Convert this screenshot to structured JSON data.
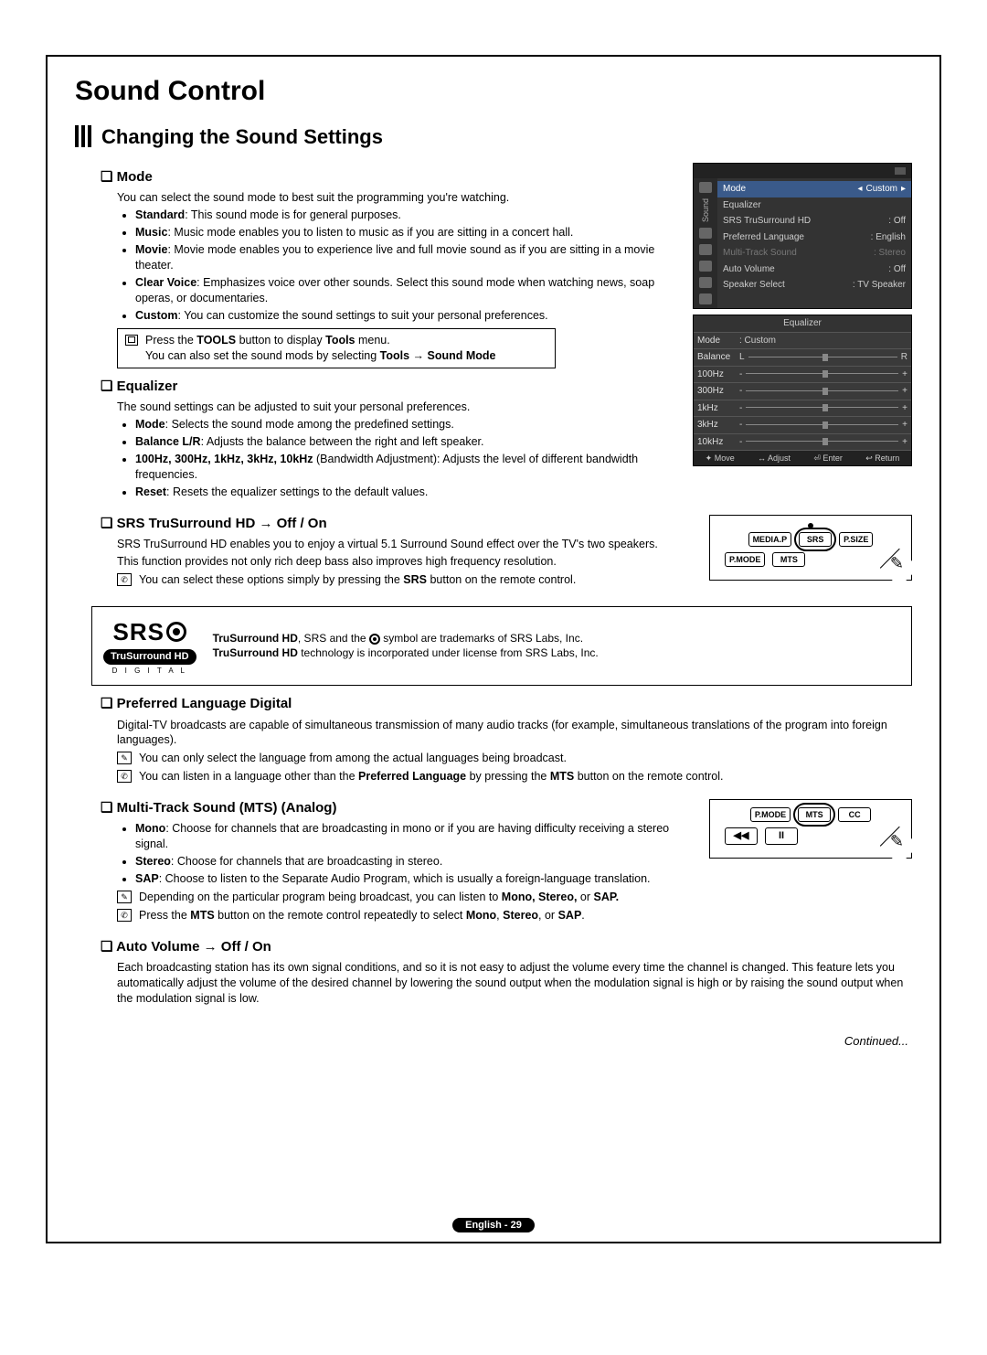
{
  "title": "Sound Control",
  "subtitle": "Changing the Sound Settings",
  "mode": {
    "heading": "Mode",
    "intro": "You can select the sound mode to best suit the programming you're watching.",
    "items": {
      "standard_b": "Standard",
      "standard_t": ": This sound mode is for general purposes.",
      "music_b": "Music",
      "music_t": ": Music mode enables you to listen to music as if you are sitting in a concert hall.",
      "movie_b": "Movie",
      "movie_t": ": Movie mode enables you to experience live and full movie sound as if you are sitting in a movie theater.",
      "clear_b": "Clear Voice",
      "clear_t": ": Emphasizes voice over other sounds. Select this sound mode when watching news, soap operas, or documentaries.",
      "custom_b": "Custom",
      "custom_t": ": You can customize the sound settings to suit your personal preferences."
    },
    "tools_note_1a": "Press the ",
    "tools_note_1b": "TOOLS",
    "tools_note_1c": " button to display ",
    "tools_note_1d": "Tools",
    "tools_note_1e": " menu.",
    "tools_note_2a": "You can also set the sound mods by selecting ",
    "tools_note_2b": "Tools → Sound Mode"
  },
  "osd_sound": {
    "vlabel": "Sound",
    "rows": [
      {
        "k": "Mode",
        "v": "Custom",
        "sel": true
      },
      {
        "k": "Equalizer",
        "v": ""
      },
      {
        "k": "SRS TruSurround HD",
        "v": ": Off"
      },
      {
        "k": "Preferred Language",
        "v": ": English"
      },
      {
        "k": "Multi-Track Sound",
        "v": ": Stereo",
        "dim": true
      },
      {
        "k": "Auto Volume",
        "v": ": Off"
      },
      {
        "k": "Speaker Select",
        "v": ": TV Speaker"
      }
    ]
  },
  "osd_eq": {
    "title": "Equalizer",
    "mode_k": "Mode",
    "mode_v": ": Custom",
    "balance_k": "Balance",
    "L": "L",
    "R": "R",
    "freq": [
      "100Hz",
      "300Hz",
      "1kHz",
      "3kHz",
      "10kHz"
    ],
    "footer": [
      "✦ Move",
      "↔ Adjust",
      "⏎ Enter",
      "↩ Return"
    ]
  },
  "equalizer": {
    "heading": "Equalizer",
    "intro": "The sound settings can be adjusted to suit your personal preferences.",
    "items": {
      "mode_b": "Mode",
      "mode_t": ": Selects the sound mode among the predefined settings.",
      "bal_b": "Balance L/R",
      "bal_t": ": Adjusts the balance between the right and left speaker.",
      "bw_b": "100Hz, 300Hz, 1kHz, 3kHz, 10kHz",
      "bw_t": " (Bandwidth Adjustment): Adjusts the level of different bandwidth frequencies.",
      "reset_b": "Reset",
      "reset_t": ": Resets the equalizer settings to the default values."
    }
  },
  "srs": {
    "heading": "SRS TruSurround HD → Off / On",
    "p1": "SRS TruSurround HD enables you to enjoy a virtual 5.1 Surround Sound effect over the TV's two speakers.",
    "p2": "This function provides not only rich deep bass also improves high frequency resolution.",
    "note_a": "You can select these options simply by pressing the ",
    "note_b": "SRS",
    "note_c": " button on the remote control."
  },
  "remote1": {
    "row1": [
      "MEDIA.P",
      "SRS",
      "P.SIZE"
    ],
    "row2": [
      "P.MODE",
      "MTS"
    ]
  },
  "srs_box": {
    "brand": "SRS",
    "chip": "TruSurround HD",
    "digital": "D I G I T A L",
    "l1_b": "TruSurround HD",
    "l1_t": ", SRS and the ",
    "l1_end": " symbol are trademarks of SRS Labs, Inc.",
    "l2_b": "TruSurround HD",
    "l2_t": " technology is incorporated under license from SRS Labs, Inc."
  },
  "pref_lang": {
    "heading": "Preferred Language Digital",
    "p1": "Digital-TV broadcasts are capable of simultaneous transmission of many audio tracks (for example, simultaneous translations of the program into foreign languages).",
    "n1": "You can only select the language from among the actual languages being broadcast.",
    "n2a": "You can listen in a language other than the ",
    "n2b": "Preferred Language",
    "n2c": " by pressing the ",
    "n2d": "MTS",
    "n2e": " button on the remote control."
  },
  "mts": {
    "heading": "Multi-Track Sound (MTS) (Analog)",
    "mono_b": "Mono",
    "mono_t": ": Choose for channels that are broadcasting in mono or if you are having difficulty receiving a stereo signal.",
    "stereo_b": "Stereo",
    "stereo_t": ": Choose for channels that are broadcasting in stereo.",
    "sap_b": "SAP",
    "sap_t": ": Choose to listen to the Separate Audio Program, which is usually a foreign-language translation.",
    "n1a": "Depending on the particular program being broadcast, you can listen to ",
    "n1b": "Mono, Stereo,",
    "n1c": " or ",
    "n1d": "SAP.",
    "n2a": "Press the ",
    "n2b": "MTS",
    "n2c": " button on the remote control repeatedly to select ",
    "n2d": "Mono",
    "n2e": ", ",
    "n2f": "Stereo",
    "n2g": ", or ",
    "n2h": "SAP",
    "n2i": "."
  },
  "remote2": {
    "row1": [
      "P.MODE",
      "MTS",
      "CC"
    ],
    "row2": [
      "◀◀",
      "II"
    ]
  },
  "autovol": {
    "heading": "Auto Volume → Off / On",
    "p1": "Each broadcasting station has its own signal conditions, and so it is not easy to adjust the volume every time the channel is changed. This feature lets you automatically adjust the volume of the desired channel by lowering the sound output when the modulation signal is high or by raising the sound output when the modulation signal is low."
  },
  "continued": "Continued...",
  "pagefoot": "English - 29"
}
